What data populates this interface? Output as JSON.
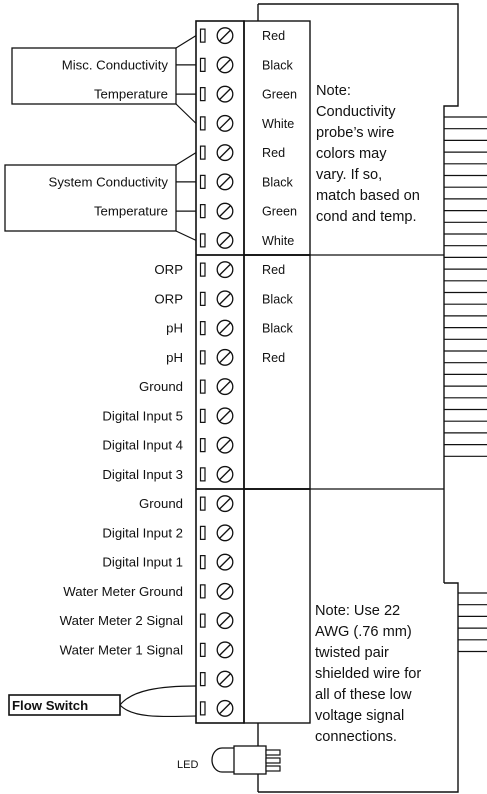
{
  "terminal_labels": [
    "",
    "Misc. Conductivity",
    "Temperature",
    "",
    "",
    "System Conductivity",
    "Temperature",
    "",
    "ORP",
    "ORP",
    "pH",
    "pH",
    "Ground",
    "Digital Input 5",
    "Digital Input 4",
    "Digital Input 3",
    "Ground",
    "Digital Input 2",
    "Digital Input 1",
    "Water Meter Ground",
    "Water Meter 2 Signal",
    "Water Meter 1 Signal",
    "",
    ""
  ],
  "wire_colors": [
    "Red",
    "Black",
    "Green",
    "White",
    "Red",
    "Black",
    "Green",
    "White",
    "Red",
    "Black",
    "Black",
    "Red",
    "",
    "",
    "",
    "",
    "",
    "",
    "",
    "",
    "",
    "",
    "",
    ""
  ],
  "notes": {
    "conductivity": [
      "Note:",
      "Conductivity",
      "probe’s wire",
      "colors may",
      "vary. If so,",
      "match based on",
      "cond and temp."
    ],
    "low_voltage": [
      "Note: Use 22",
      "AWG (.76 mm)",
      "twisted pair",
      "shielded wire for",
      "all of these low",
      "voltage signal",
      "connections."
    ]
  },
  "flow_switch": "Flow Switch",
  "led": "LED"
}
